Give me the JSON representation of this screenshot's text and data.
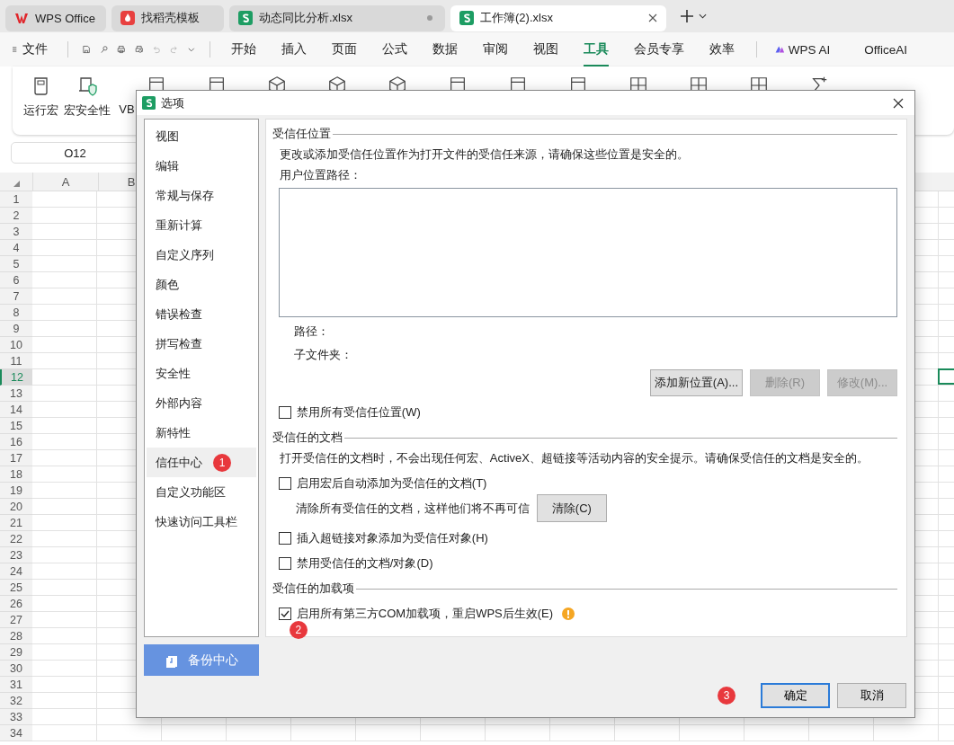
{
  "app_tabs": [
    {
      "label": "WPS Office",
      "kind": "home",
      "selected": false
    },
    {
      "label": "找稻壳模板",
      "kind": "docer",
      "selected": false
    },
    {
      "label": "动态同比分析.xlsx",
      "kind": "sheet",
      "selected": false
    },
    {
      "label": "工作簿(2).xlsx",
      "kind": "sheet",
      "selected": true
    }
  ],
  "menu": {
    "file": "文件",
    "items": [
      {
        "label": "开始",
        "selected": false
      },
      {
        "label": "插入",
        "selected": false
      },
      {
        "label": "页面",
        "selected": false
      },
      {
        "label": "公式",
        "selected": false
      },
      {
        "label": "数据",
        "selected": false
      },
      {
        "label": "审阅",
        "selected": false
      },
      {
        "label": "视图",
        "selected": false
      },
      {
        "label": "工具",
        "selected": true
      },
      {
        "label": "会员专享",
        "selected": false
      },
      {
        "label": "效率",
        "selected": false
      }
    ],
    "ai_items": [
      "WPS AI",
      "OfficeAI"
    ]
  },
  "ribbon": [
    {
      "label": "运行宏",
      "kind": "run"
    },
    {
      "label": "宏安全性",
      "kind": "security"
    },
    {
      "label": "VB",
      "kind": "editor"
    }
  ],
  "name_box": "O12",
  "sheet": {
    "columns": [
      "A",
      "B"
    ],
    "rows": [
      {
        "label": "1",
        "selected": false
      },
      {
        "label": "2",
        "selected": false
      },
      {
        "label": "3",
        "selected": false
      },
      {
        "label": "4",
        "selected": false
      },
      {
        "label": "5",
        "selected": false
      },
      {
        "label": "6",
        "selected": false
      },
      {
        "label": "7",
        "selected": false
      },
      {
        "label": "8",
        "selected": false
      },
      {
        "label": "9",
        "selected": false
      },
      {
        "label": "10",
        "selected": false
      },
      {
        "label": "11",
        "selected": false
      },
      {
        "label": "12",
        "selected": true
      },
      {
        "label": "13",
        "selected": false
      },
      {
        "label": "14",
        "selected": false
      },
      {
        "label": "15",
        "selected": false
      },
      {
        "label": "16",
        "selected": false
      },
      {
        "label": "17",
        "selected": false
      },
      {
        "label": "18",
        "selected": false
      },
      {
        "label": "19",
        "selected": false
      },
      {
        "label": "20",
        "selected": false
      },
      {
        "label": "21",
        "selected": false
      },
      {
        "label": "22",
        "selected": false
      },
      {
        "label": "23",
        "selected": false
      },
      {
        "label": "24",
        "selected": false
      },
      {
        "label": "25",
        "selected": false
      },
      {
        "label": "26",
        "selected": false
      },
      {
        "label": "27",
        "selected": false
      },
      {
        "label": "28",
        "selected": false
      },
      {
        "label": "29",
        "selected": false
      },
      {
        "label": "30",
        "selected": false
      },
      {
        "label": "31",
        "selected": false
      },
      {
        "label": "32",
        "selected": false
      },
      {
        "label": "33",
        "selected": false
      },
      {
        "label": "34",
        "selected": false
      }
    ]
  },
  "dialog": {
    "title": "选项",
    "nav": [
      {
        "label": "视图",
        "selected": false
      },
      {
        "label": "编辑",
        "selected": false
      },
      {
        "label": "常规与保存",
        "selected": false
      },
      {
        "label": "重新计算",
        "selected": false
      },
      {
        "label": "自定义序列",
        "selected": false
      },
      {
        "label": "颜色",
        "selected": false
      },
      {
        "label": "错误检查",
        "selected": false
      },
      {
        "label": "拼写检查",
        "selected": false
      },
      {
        "label": "安全性",
        "selected": false
      },
      {
        "label": "外部内容",
        "selected": false
      },
      {
        "label": "新特性",
        "selected": false
      },
      {
        "label": "信任中心",
        "selected": true,
        "badge": "1"
      },
      {
        "label": "自定义功能区",
        "selected": false
      },
      {
        "label": "快速访问工具栏",
        "selected": false
      }
    ],
    "backup": "备份中心",
    "sections": [
      {
        "title": "受信任位置",
        "items": [
          {
            "kind": "text",
            "text": "更改或添加受信任位置作为打开文件的受信任来源，请确保这些位置是安全的。"
          },
          {
            "kind": "text",
            "text": "用户位置路径："
          },
          {
            "kind": "listbox"
          },
          {
            "kind": "detail",
            "text": "路径："
          },
          {
            "kind": "detail",
            "text": "子文件夹："
          },
          {
            "kind": "buttons",
            "buttons": [
              {
                "label": "添加新位置(A)...",
                "disabled": false
              },
              {
                "label": "删除(R)",
                "disabled": true
              },
              {
                "label": "修改(M)...",
                "disabled": true
              }
            ]
          },
          {
            "kind": "checkbox",
            "label": "禁用所有受信任位置(W)",
            "checked": false
          }
        ]
      },
      {
        "title": "受信任的文档",
        "items": [
          {
            "kind": "text",
            "text": "打开受信任的文档时，不会出现任何宏、ActiveX、超链接等活动内容的安全提示。请确保受信任的文档是安全的。"
          },
          {
            "kind": "checkbox",
            "label": "启用宏后自动添加为受信任的文档(T)",
            "checked": false
          },
          {
            "kind": "action",
            "text": "清除所有受信任的文档，这样他们将不再可信",
            "button": "清除(C)"
          },
          {
            "kind": "checkbox",
            "label": "插入超链接对象添加为受信任对象(H)",
            "checked": false
          },
          {
            "kind": "checkbox",
            "label": "禁用受信任的文档/对象(D)",
            "checked": false
          }
        ]
      },
      {
        "title": "受信任的加载项",
        "items": [
          {
            "kind": "checkbox",
            "label": "启用所有第三方COM加载项，重启WPS后生效(E)",
            "checked": true,
            "warning": true,
            "badge": "2"
          }
        ]
      }
    ],
    "buttons": [
      {
        "label": "确定",
        "kind": "primary",
        "badge": "3"
      },
      {
        "label": "取消",
        "kind": "normal"
      }
    ]
  }
}
